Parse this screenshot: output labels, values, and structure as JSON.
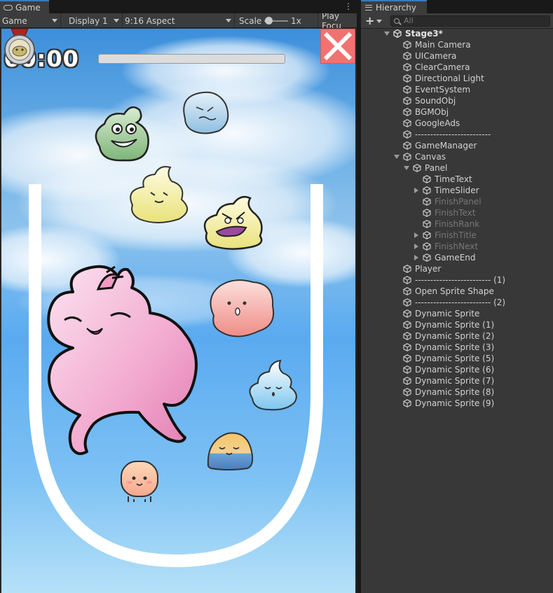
{
  "game": {
    "tab_label": "Game",
    "toolbar": {
      "mode": "Game",
      "display": "Display 1",
      "aspect": "9:16 Aspect",
      "scale_label": "Scale",
      "scale_value": "1x",
      "play_focus": "Play Focu"
    },
    "timer": "00:00",
    "time_slider_progress": 0
  },
  "hierarchy": {
    "tab_label": "Hierarchy",
    "search_placeholder": "All",
    "add_label": "+",
    "scene_name": "Stage3*",
    "items": [
      {
        "label": "Main Camera",
        "depth": 1,
        "expand": "none",
        "dim": false
      },
      {
        "label": "UICamera",
        "depth": 1,
        "expand": "none",
        "dim": false
      },
      {
        "label": "ClearCamera",
        "depth": 1,
        "expand": "none",
        "dim": false
      },
      {
        "label": "Directional Light",
        "depth": 1,
        "expand": "none",
        "dim": false
      },
      {
        "label": "EventSystem",
        "depth": 1,
        "expand": "none",
        "dim": false
      },
      {
        "label": "SoundObj",
        "depth": 1,
        "expand": "none",
        "dim": false
      },
      {
        "label": "BGMObj",
        "depth": 1,
        "expand": "none",
        "dim": false
      },
      {
        "label": "GoogleAds",
        "depth": 1,
        "expand": "none",
        "dim": false
      },
      {
        "label": "-------------------------",
        "depth": 1,
        "expand": "none",
        "dim": false
      },
      {
        "label": "GameManager",
        "depth": 1,
        "expand": "none",
        "dim": false
      },
      {
        "label": "Canvas",
        "depth": 1,
        "expand": "down",
        "dim": false
      },
      {
        "label": "Panel",
        "depth": 2,
        "expand": "down",
        "dim": false
      },
      {
        "label": "TimeText",
        "depth": 3,
        "expand": "none",
        "dim": false
      },
      {
        "label": "TimeSlider",
        "depth": 3,
        "expand": "right",
        "dim": false
      },
      {
        "label": "FinishPanel",
        "depth": 3,
        "expand": "none",
        "dim": true
      },
      {
        "label": "FinishText",
        "depth": 3,
        "expand": "none",
        "dim": true
      },
      {
        "label": "FinishRank",
        "depth": 3,
        "expand": "none",
        "dim": true
      },
      {
        "label": "FinishTitle",
        "depth": 3,
        "expand": "right",
        "dim": true
      },
      {
        "label": "FinishNext",
        "depth": 3,
        "expand": "right",
        "dim": true
      },
      {
        "label": "GameEnd",
        "depth": 3,
        "expand": "right",
        "dim": false
      },
      {
        "label": "Player",
        "depth": 1,
        "expand": "none",
        "dim": false
      },
      {
        "label": "------------------------- (1)",
        "depth": 1,
        "expand": "none",
        "dim": false
      },
      {
        "label": "Open Sprite Shape",
        "depth": 1,
        "expand": "none",
        "dim": false
      },
      {
        "label": "------------------------- (2)",
        "depth": 1,
        "expand": "none",
        "dim": false
      },
      {
        "label": "Dynamic Sprite",
        "depth": 1,
        "expand": "none",
        "dim": false
      },
      {
        "label": "Dynamic Sprite (1)",
        "depth": 1,
        "expand": "none",
        "dim": false
      },
      {
        "label": "Dynamic Sprite (2)",
        "depth": 1,
        "expand": "none",
        "dim": false
      },
      {
        "label": "Dynamic Sprite (3)",
        "depth": 1,
        "expand": "none",
        "dim": false
      },
      {
        "label": "Dynamic Sprite (5)",
        "depth": 1,
        "expand": "none",
        "dim": false
      },
      {
        "label": "Dynamic Sprite (6)",
        "depth": 1,
        "expand": "none",
        "dim": false
      },
      {
        "label": "Dynamic Sprite (7)",
        "depth": 1,
        "expand": "none",
        "dim": false
      },
      {
        "label": "Dynamic Sprite (8)",
        "depth": 1,
        "expand": "none",
        "dim": false
      },
      {
        "label": "Dynamic Sprite (9)",
        "depth": 1,
        "expand": "none",
        "dim": false
      }
    ]
  },
  "icons": {
    "game_tab": "gamepad-icon",
    "hierarchy_tab": "list-icon",
    "search": "search-icon",
    "scene": "unity-scene-icon",
    "gameobject": "cube-icon",
    "close": "close-icon",
    "medal": "medal-icon"
  },
  "colors": {
    "accent": "#3a79bb",
    "close_button": "#f27272",
    "sky_top": "#3c8fdb",
    "sky_bottom": "#b5e1f8"
  }
}
